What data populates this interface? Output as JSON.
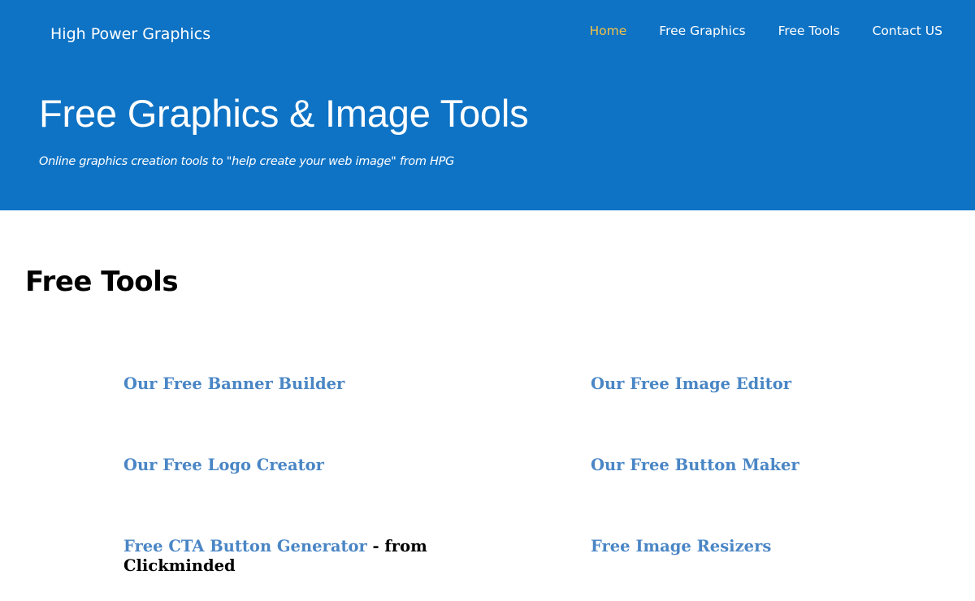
{
  "header": {
    "brand": "High Power Graphics",
    "nav": [
      {
        "label": "Home",
        "active": true
      },
      {
        "label": "Free Graphics",
        "active": false
      },
      {
        "label": "Free Tools",
        "active": false
      },
      {
        "label": "Contact US",
        "active": false
      }
    ],
    "title": "Free Graphics & Image Tools",
    "subtitle": "Online graphics creation tools to \"help create your web image\" from HPG"
  },
  "main": {
    "section_title": "Free Tools",
    "tools": [
      {
        "label": "Our Free Banner Builder"
      },
      {
        "label": "Our Free Image Editor"
      },
      {
        "label": "Our Free Logo Creator"
      },
      {
        "label": "Our Free Button Maker"
      },
      {
        "label": "Free CTA Button Generator",
        "suffix": " - from",
        "suffix_line2": "Clickminded"
      },
      {
        "label": "Free Image Resizers"
      }
    ]
  },
  "colors": {
    "header_bg": "#0e73c5",
    "nav_active": "#f3c245",
    "link": "#4a86c5"
  }
}
